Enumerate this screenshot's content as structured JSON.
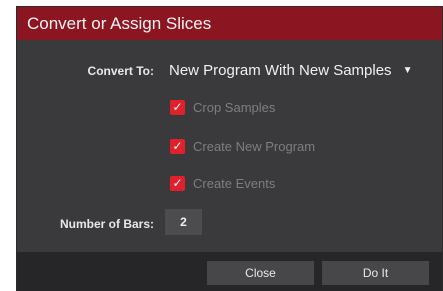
{
  "dialog": {
    "title": "Convert or Assign Slices"
  },
  "convert_to": {
    "label": "Convert To:",
    "selected": "New Program With New Samples",
    "caret_icon": "triangle-down-icon"
  },
  "options": [
    {
      "label": "Crop Samples",
      "checked": true
    },
    {
      "label": "Create New Program",
      "checked": true
    },
    {
      "label": "Create Events",
      "checked": true
    }
  ],
  "number_of_bars": {
    "label": "Number of Bars:",
    "value": "2"
  },
  "buttons": {
    "close": "Close",
    "do_it": "Do It"
  },
  "colors": {
    "title_bar": "#8b1621",
    "checkbox": "#e0202a",
    "background": "#3a3a3c",
    "footer": "#262628"
  }
}
